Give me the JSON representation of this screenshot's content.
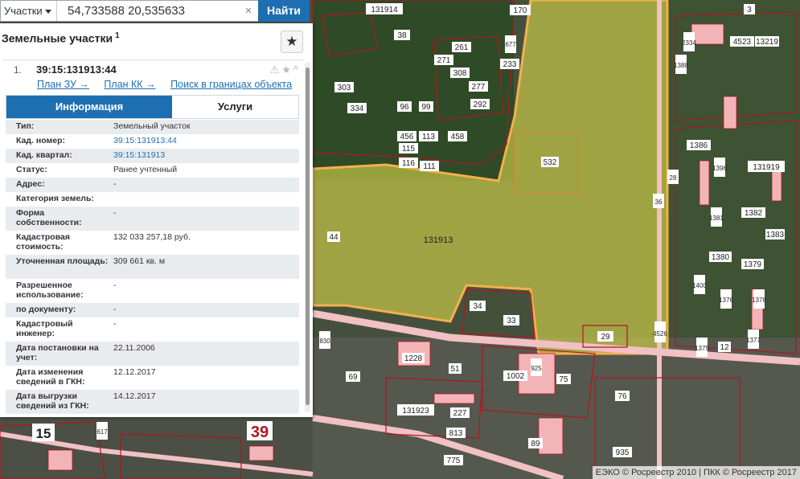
{
  "search": {
    "type_label": "Участки",
    "query": "54,733588 20,535633",
    "clear": "×",
    "find_label": "Найти"
  },
  "panel": {
    "title": "Земельные участки",
    "title_count": "1",
    "result": {
      "num": "1.",
      "cad_number": "39:15:131913:44",
      "icons": "⚠★^"
    },
    "links": [
      "План ЗУ →",
      "План КК →",
      "Поиск в границах объекта →"
    ],
    "tabs": [
      "Информация",
      "Услуги"
    ],
    "rows": [
      {
        "k": "Тип:",
        "v": "Земельный участок"
      },
      {
        "k": "Кад. номер:",
        "v": "39:15:131913:44",
        "link": true
      },
      {
        "k": "Кад. квартал:",
        "v": "39:15:131913",
        "link": true
      },
      {
        "k": "Статус:",
        "v": "Ранее учтенный"
      },
      {
        "k": "Адрес:",
        "v": "-"
      },
      {
        "k": "Категория земель:",
        "v": ""
      },
      {
        "k": "Форма собственности:",
        "v": "-"
      },
      {
        "k": "Кадастровая стоимость:",
        "v": "132 033 257,18 руб."
      },
      {
        "k": "Уточненная площадь:",
        "v": "309 661 кв. м"
      },
      {
        "k": "Разрешенное использование:",
        "v": "-"
      },
      {
        "k": "по документу:",
        "v": "-"
      },
      {
        "k": "Кадастровый инженер:",
        "v": "-"
      },
      {
        "k": "Дата постановки на учет:",
        "v": "22.11.2006"
      },
      {
        "k": "Дата изменения сведений в ГКН:",
        "v": "12.12.2017"
      },
      {
        "k": "Дата выгрузки сведений из ГКН:",
        "v": "14.12.2017"
      }
    ]
  },
  "map": {
    "labels": [
      "170",
      "131914",
      "38",
      "261",
      "677",
      "233",
      "3",
      "131919",
      "4523",
      "13219",
      "2334",
      "1388",
      "303",
      "334",
      "96",
      "99",
      "456",
      "113",
      "458",
      "115",
      "116",
      "111",
      "271",
      "308",
      "277",
      "292",
      "1386",
      "1396",
      "1382",
      "1381",
      "1383",
      "1380",
      "1379",
      "1400",
      "1376",
      "1378",
      "1375",
      "1377",
      "532",
      "131913",
      "44",
      "34",
      "33",
      "29",
      "830",
      "1228",
      "51",
      "1002",
      "925",
      "75",
      "76",
      "69",
      "131923",
      "89",
      "935",
      "39",
      "15",
      "775",
      "813",
      "617",
      "36",
      "28",
      "4526",
      "12",
      "227"
    ],
    "credits": "ЕЭКО © Росреестр 2010 | ПКК © Росреестр 2017"
  },
  "colors": {
    "accent": "#1e6fb2",
    "parcel_line": "#b0171e",
    "selected_fill": "#d8d64a",
    "selected_border": "#f4b04d"
  }
}
